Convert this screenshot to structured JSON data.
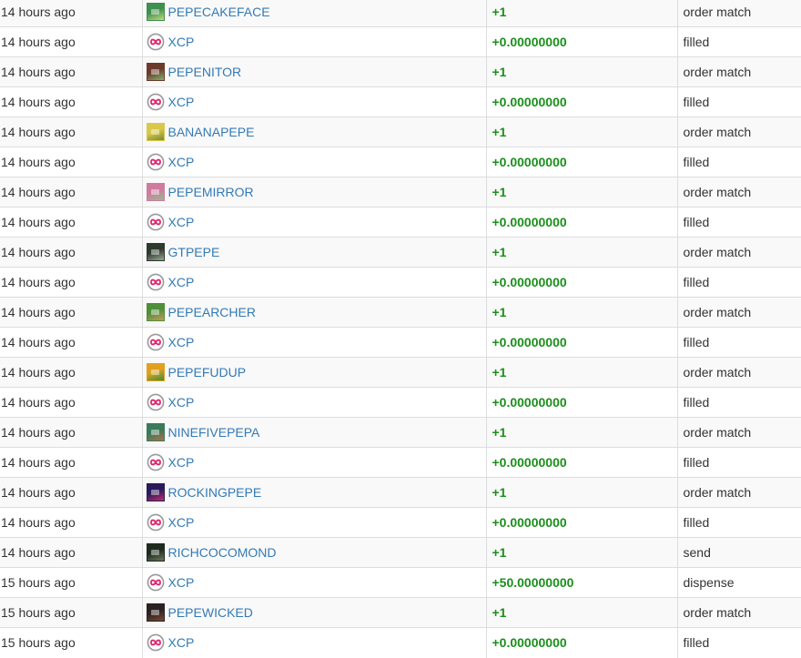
{
  "colors": {
    "link": "#337ab7",
    "positive": "#1a8f1a",
    "xcp_ring": "#999999",
    "xcp_mark": "#e0246e"
  },
  "rows": [
    {
      "time": "14 hours ago",
      "asset": "PEPECAKEFACE",
      "icon": "pepecakeface-thumb",
      "thumb": [
        "#3f8f50",
        "#c8d97a"
      ],
      "quantity": "+1",
      "type": "order match"
    },
    {
      "time": "14 hours ago",
      "asset": "XCP",
      "icon": "xcp-icon",
      "quantity": "+0.00000000",
      "type": "filled"
    },
    {
      "time": "14 hours ago",
      "asset": "PEPENITOR",
      "icon": "pepenitor-thumb",
      "thumb": [
        "#6b3a2a",
        "#7fb36a"
      ],
      "quantity": "+1",
      "type": "order match"
    },
    {
      "time": "14 hours ago",
      "asset": "XCP",
      "icon": "xcp-icon",
      "quantity": "+0.00000000",
      "type": "filled"
    },
    {
      "time": "14 hours ago",
      "asset": "BANANAPEPE",
      "icon": "bananapepe-thumb",
      "thumb": [
        "#d9c84a",
        "#7a8a30"
      ],
      "quantity": "+1",
      "type": "order match"
    },
    {
      "time": "14 hours ago",
      "asset": "XCP",
      "icon": "xcp-icon",
      "quantity": "+0.00000000",
      "type": "filled"
    },
    {
      "time": "14 hours ago",
      "asset": "PEPEMIRROR",
      "icon": "pepemirror-thumb",
      "thumb": [
        "#d07aa0",
        "#8fbf8f"
      ],
      "quantity": "+1",
      "type": "order match"
    },
    {
      "time": "14 hours ago",
      "asset": "XCP",
      "icon": "xcp-icon",
      "quantity": "+0.00000000",
      "type": "filled"
    },
    {
      "time": "14 hours ago",
      "asset": "GTPEPE",
      "icon": "gtpepe-thumb",
      "thumb": [
        "#2e3a2e",
        "#9aa89a"
      ],
      "quantity": "+1",
      "type": "order match"
    },
    {
      "time": "14 hours ago",
      "asset": "XCP",
      "icon": "xcp-icon",
      "quantity": "+0.00000000",
      "type": "filled"
    },
    {
      "time": "14 hours ago",
      "asset": "PEPEARCHER",
      "icon": "pepearcher-thumb",
      "thumb": [
        "#4f8f3a",
        "#c89a5a"
      ],
      "quantity": "+1",
      "type": "order match"
    },
    {
      "time": "14 hours ago",
      "asset": "XCP",
      "icon": "xcp-icon",
      "quantity": "+0.00000000",
      "type": "filled"
    },
    {
      "time": "14 hours ago",
      "asset": "PEPEFUDUP",
      "icon": "pepefudup-thumb",
      "thumb": [
        "#e0a020",
        "#3a8f3a"
      ],
      "quantity": "+1",
      "type": "order match"
    },
    {
      "time": "14 hours ago",
      "asset": "XCP",
      "icon": "xcp-icon",
      "quantity": "+0.00000000",
      "type": "filled"
    },
    {
      "time": "14 hours ago",
      "asset": "NINEFIVEPEPA",
      "icon": "ninefivepepa-thumb",
      "thumb": [
        "#3a7a5a",
        "#b0704a"
      ],
      "quantity": "+1",
      "type": "order match"
    },
    {
      "time": "14 hours ago",
      "asset": "XCP",
      "icon": "xcp-icon",
      "quantity": "+0.00000000",
      "type": "filled"
    },
    {
      "time": "14 hours ago",
      "asset": "ROCKINGPEPE",
      "icon": "rockingpepe-thumb",
      "thumb": [
        "#2a1a5a",
        "#c0306a"
      ],
      "quantity": "+1",
      "type": "order match"
    },
    {
      "time": "14 hours ago",
      "asset": "XCP",
      "icon": "xcp-icon",
      "quantity": "+0.00000000",
      "type": "filled"
    },
    {
      "time": "14 hours ago",
      "asset": "RICHCOCOMOND",
      "icon": "richcocomond-thumb",
      "thumb": [
        "#1e2a1e",
        "#6a7a5a"
      ],
      "quantity": "+1",
      "type": "send"
    },
    {
      "time": "15 hours ago",
      "asset": "XCP",
      "icon": "xcp-icon",
      "quantity": "+50.00000000",
      "type": "dispense"
    },
    {
      "time": "15 hours ago",
      "asset": "PEPEWICKED",
      "icon": "pepewicked-thumb",
      "thumb": [
        "#2a2220",
        "#7a4a3a"
      ],
      "quantity": "+1",
      "type": "order match"
    },
    {
      "time": "15 hours ago",
      "asset": "XCP",
      "icon": "xcp-icon",
      "quantity": "+0.00000000",
      "type": "filled"
    }
  ]
}
